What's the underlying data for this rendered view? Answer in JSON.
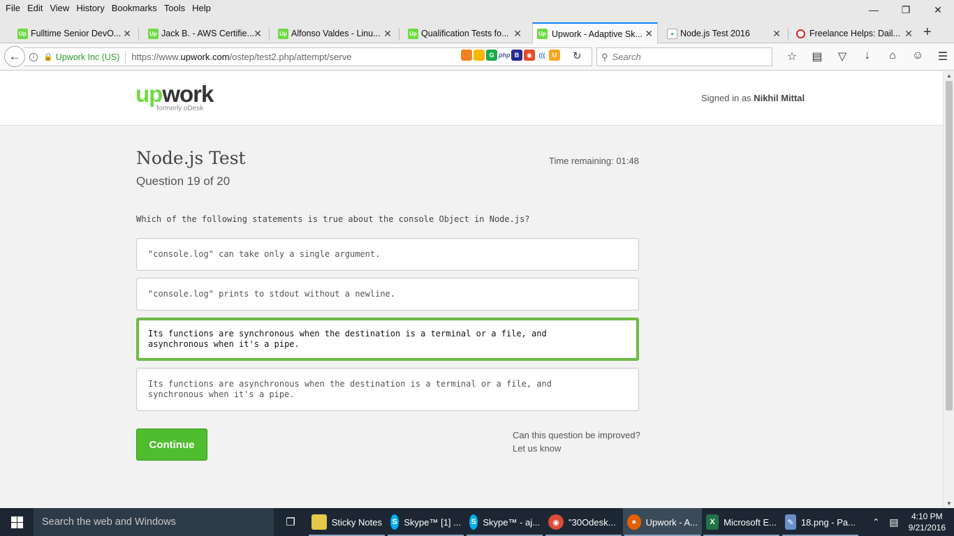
{
  "menubar": {
    "items": [
      "File",
      "Edit",
      "View",
      "History",
      "Bookmarks",
      "Tools",
      "Help"
    ]
  },
  "tabs": [
    {
      "title": "Fulltime Senior DevO...",
      "favicon": "upwork-icon",
      "active": false
    },
    {
      "title": "Jack B. - AWS Certifie...",
      "favicon": "upwork-icon",
      "active": false
    },
    {
      "title": "Alfonso Valdes - Linu...",
      "favicon": "upwork-icon",
      "active": false
    },
    {
      "title": "Qualification Tests fo...",
      "favicon": "upwork-icon",
      "active": false
    },
    {
      "title": "Upwork - Adaptive Sk...",
      "favicon": "upwork-icon",
      "active": true
    },
    {
      "title": "Node.js Test 2016",
      "favicon": "nodejs-icon",
      "active": false
    },
    {
      "title": "Freelance Helps: Dail...",
      "favicon": "freelancehelps-icon",
      "active": false
    }
  ],
  "navbar": {
    "identity": "Upwork Inc (US)",
    "url_prefix": "https://www.",
    "url_domain": "upwork.com",
    "url_path": "/ostep/test2.php/attempt/serve",
    "search_placeholder": "Search"
  },
  "page": {
    "logo_sub": "formerly oDesk",
    "signed_in_prefix": "Signed in as",
    "user_name": "Nikhil Mittal",
    "test_title": "Node.js Test",
    "question_number": "Question 19 of 20",
    "time_remaining": "Time remaining: 01:48",
    "question_text": "Which of the following statements is true about the console Object in Node.js?",
    "options": [
      {
        "line1": "\"console.log\" can take only a single argument.",
        "line2": "",
        "selected": false
      },
      {
        "line1": "\"console.log\" prints to stdout without a newline.",
        "line2": "",
        "selected": false
      },
      {
        "line1": "Its functions are synchronous when the destination is a terminal or a file, and",
        "line2": "asynchronous when it's a pipe.",
        "selected": true
      },
      {
        "line1": "Its functions are asynchronous when the destination is a terminal or a file, and",
        "line2": "synchronous when it's a pipe.",
        "selected": false
      }
    ],
    "continue_label": "Continue",
    "improve_line1": "Can this question be improved?",
    "improve_line2": "Let us know"
  },
  "taskbar": {
    "search_placeholder": "Search the web and Windows",
    "apps": [
      {
        "label": "Sticky Notes",
        "icon": "sticky-notes-icon",
        "color": "#e3c84a",
        "active": false
      },
      {
        "label": "Skype™ [1] ...",
        "icon": "skype-icon",
        "color": "#00aff0",
        "active": false
      },
      {
        "label": "Skype™ - aj...",
        "icon": "skype-icon",
        "color": "#00aff0",
        "active": false
      },
      {
        "label": "\"30Odesk...",
        "icon": "chrome-icon",
        "color": "#dd4b39",
        "active": false
      },
      {
        "label": "Upwork - A...",
        "icon": "firefox-icon",
        "color": "#e66000",
        "active": true
      },
      {
        "label": "Microsoft E...",
        "icon": "excel-icon",
        "color": "#217346",
        "active": false
      },
      {
        "label": "18.png - Pa...",
        "icon": "paint-icon",
        "color": "#6a8fc7",
        "active": false
      }
    ],
    "time": "4:10 PM",
    "date": "9/21/2016"
  },
  "colors": {
    "upwork_green": "#6fda44",
    "selected_border": "#6fba44",
    "continue_button": "#4fbd2e",
    "taskbar": "#1c2733"
  }
}
